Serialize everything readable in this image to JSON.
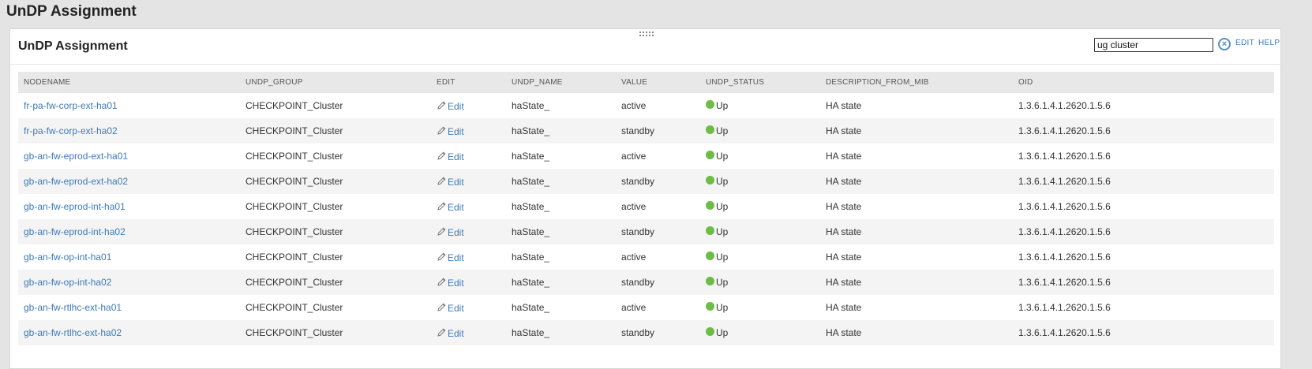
{
  "page": {
    "title": "UnDP Assignment"
  },
  "panel": {
    "title": "UnDP Assignment",
    "search_value": "ug cluster",
    "clear_icon": "×",
    "edit_label": "EDIT",
    "help_label": "HELP"
  },
  "colors": {
    "accent": "#3d7ab8",
    "status_up": "#6cbd45"
  },
  "table": {
    "columns": [
      "NODENAME",
      "UNDP_GROUP",
      "EDIT",
      "UNDP_NAME",
      "VALUE",
      "UNDP_STATUS",
      "DESCRIPTION_FROM_MIB",
      "OID"
    ],
    "rows": [
      {
        "node": "fr-pa-fw-corp-ext-ha01",
        "group": "CHECKPOINT_Cluster",
        "edit": "Edit",
        "name": "haState_",
        "value": "active",
        "status": "Up",
        "description": "HA state",
        "oid": "1.3.6.1.4.1.2620.1.5.6"
      },
      {
        "node": "fr-pa-fw-corp-ext-ha02",
        "group": "CHECKPOINT_Cluster",
        "edit": "Edit",
        "name": "haState_",
        "value": "standby",
        "status": "Up",
        "description": "HA state",
        "oid": "1.3.6.1.4.1.2620.1.5.6"
      },
      {
        "node": "gb-an-fw-eprod-ext-ha01",
        "group": "CHECKPOINT_Cluster",
        "edit": "Edit",
        "name": "haState_",
        "value": "active",
        "status": "Up",
        "description": "HA state",
        "oid": "1.3.6.1.4.1.2620.1.5.6"
      },
      {
        "node": "gb-an-fw-eprod-ext-ha02",
        "group": "CHECKPOINT_Cluster",
        "edit": "Edit",
        "name": "haState_",
        "value": "standby",
        "status": "Up",
        "description": "HA state",
        "oid": "1.3.6.1.4.1.2620.1.5.6"
      },
      {
        "node": "gb-an-fw-eprod-int-ha01",
        "group": "CHECKPOINT_Cluster",
        "edit": "Edit",
        "name": "haState_",
        "value": "active",
        "status": "Up",
        "description": "HA state",
        "oid": "1.3.6.1.4.1.2620.1.5.6"
      },
      {
        "node": "gb-an-fw-eprod-int-ha02",
        "group": "CHECKPOINT_Cluster",
        "edit": "Edit",
        "name": "haState_",
        "value": "standby",
        "status": "Up",
        "description": "HA state",
        "oid": "1.3.6.1.4.1.2620.1.5.6"
      },
      {
        "node": "gb-an-fw-op-int-ha01",
        "group": "CHECKPOINT_Cluster",
        "edit": "Edit",
        "name": "haState_",
        "value": "active",
        "status": "Up",
        "description": "HA state",
        "oid": "1.3.6.1.4.1.2620.1.5.6"
      },
      {
        "node": "gb-an-fw-op-int-ha02",
        "group": "CHECKPOINT_Cluster",
        "edit": "Edit",
        "name": "haState_",
        "value": "standby",
        "status": "Up",
        "description": "HA state",
        "oid": "1.3.6.1.4.1.2620.1.5.6"
      },
      {
        "node": "gb-an-fw-rtlhc-ext-ha01",
        "group": "CHECKPOINT_Cluster",
        "edit": "Edit",
        "name": "haState_",
        "value": "active",
        "status": "Up",
        "description": "HA state",
        "oid": "1.3.6.1.4.1.2620.1.5.6"
      },
      {
        "node": "gb-an-fw-rtlhc-ext-ha02",
        "group": "CHECKPOINT_Cluster",
        "edit": "Edit",
        "name": "haState_",
        "value": "standby",
        "status": "Up",
        "description": "HA state",
        "oid": "1.3.6.1.4.1.2620.1.5.6"
      }
    ]
  }
}
